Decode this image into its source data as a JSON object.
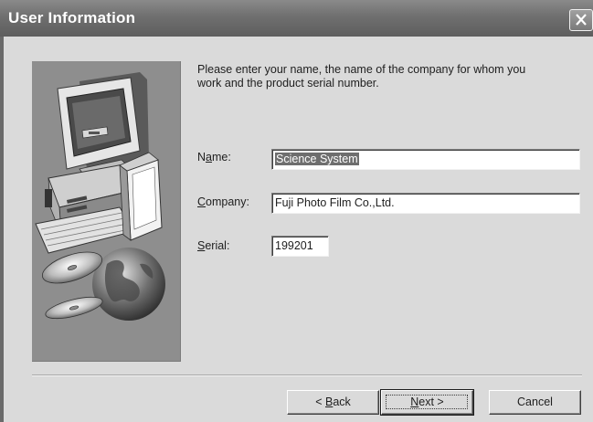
{
  "window": {
    "title": "User Information"
  },
  "intro": {
    "line1": "Please enter your name, the name of the company for whom you",
    "line2": "work and the product serial number."
  },
  "fields": {
    "name": {
      "label_prefix": "N",
      "label_mnemonic": "a",
      "label_suffix": "me:",
      "value": "Science System"
    },
    "company": {
      "label_mnemonic": "C",
      "label_suffix": "ompany:",
      "value": "Fuji Photo Film Co.,Ltd."
    },
    "serial": {
      "label_mnemonic": "S",
      "label_suffix": "erial:",
      "value": "199201"
    }
  },
  "buttons": {
    "back": {
      "prefix": "< ",
      "mnemonic": "B",
      "suffix": "ack"
    },
    "next": {
      "mnemonic": "N",
      "suffix": "ext >"
    },
    "cancel": {
      "label": "Cancel"
    }
  },
  "icons": {
    "close": "close-icon",
    "illustration": "setup-computer-illustration"
  }
}
